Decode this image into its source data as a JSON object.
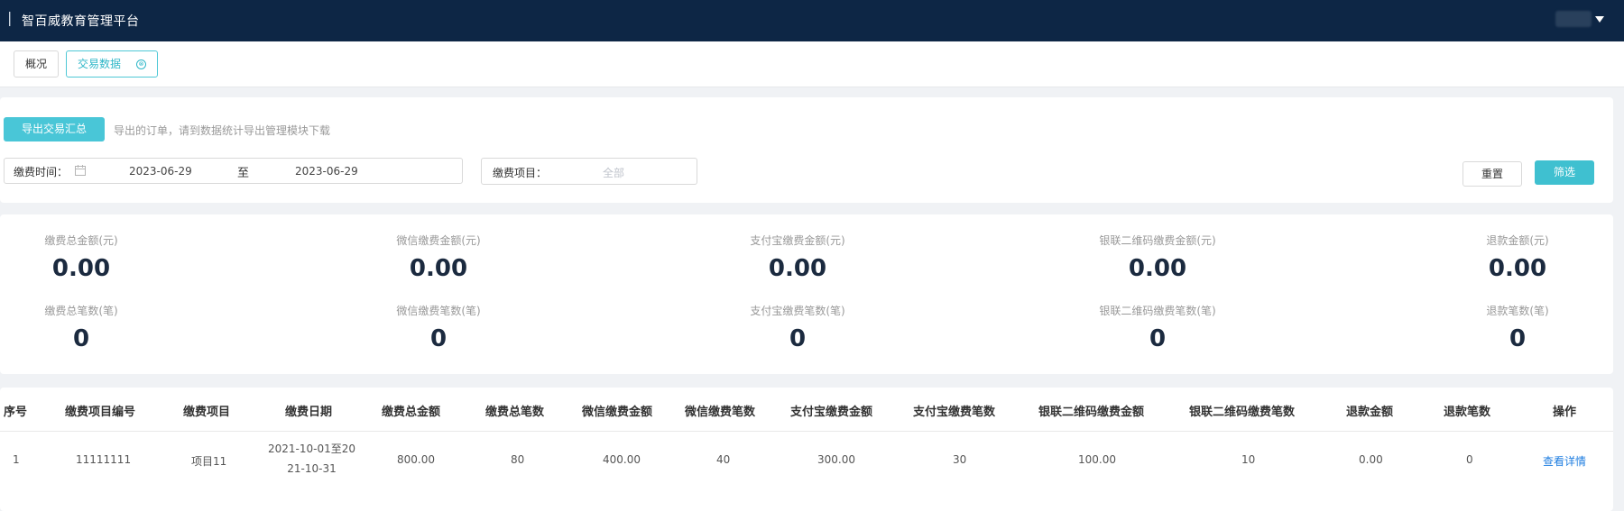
{
  "header": {
    "separator": "|",
    "app_title": "智百威教育管理平台"
  },
  "tabs": [
    {
      "label": "概况"
    },
    {
      "label": "交易数据",
      "close_icon": "⊗"
    }
  ],
  "filter": {
    "export_button": "导出交易汇总",
    "export_hint": "导出的订单，请到数据统计导出管理模块下载",
    "date_label": "缴费时间：",
    "date_start": "2023-06-29",
    "date_to": "至",
    "date_end": "2023-06-29",
    "project_label": "缴费项目：",
    "project_value": "全部",
    "reset_button": "重置",
    "filter_button": "筛选"
  },
  "stats": [
    {
      "label": "缴费总金额(元)",
      "value": "0.00"
    },
    {
      "label": "微信缴费金额(元)",
      "value": "0.00"
    },
    {
      "label": "支付宝缴费金额(元)",
      "value": "0.00"
    },
    {
      "label": "银联二维码缴费金额(元)",
      "value": "0.00"
    },
    {
      "label": "退款金额(元)",
      "value": "0.00"
    },
    {
      "label": "缴费总笔数(笔)",
      "value": "0"
    },
    {
      "label": "微信缴费笔数(笔)",
      "value": "0"
    },
    {
      "label": "支付宝缴费笔数(笔)",
      "value": "0"
    },
    {
      "label": "银联二维码缴费笔数(笔)",
      "value": "0"
    },
    {
      "label": "退款笔数(笔)",
      "value": "0"
    }
  ],
  "table": {
    "headers": [
      "序号",
      "缴费项目编号",
      "缴费项目",
      "缴费日期",
      "缴费总金额",
      "缴费总笔数",
      "微信缴费金额",
      "微信缴费笔数",
      "支付宝缴费金额",
      "支付宝缴费笔数",
      "银联二维码缴费金额",
      "银联二维码缴费笔数",
      "退款金额",
      "退款笔数",
      "操作"
    ],
    "rows": [
      {
        "index": "1",
        "project_code": "11111111",
        "project_name": "项目11",
        "date_line1": "2021-10-01至20",
        "date_line2": "21-10-31",
        "total_amount": "800.00",
        "total_count": "80",
        "wechat_amount": "400.00",
        "wechat_count": "40",
        "alipay_amount": "300.00",
        "alipay_count": "30",
        "unionpay_amount": "100.00",
        "unionpay_count": "10",
        "refund_amount": "0.00",
        "refund_count": "0",
        "action": "查看详情"
      }
    ]
  },
  "colors": {
    "topbar": "#0d2645",
    "accent": "#49c6d7",
    "link": "#1f7ee0"
  }
}
